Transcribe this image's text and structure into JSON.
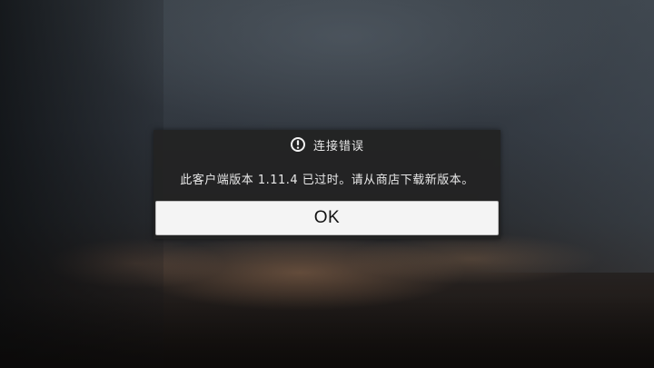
{
  "dialog": {
    "title": "连接错误",
    "title_icon": "alert-circle-icon",
    "message": "此客户端版本 1.11.4 已过时。请从商店下载新版本。",
    "ok_label": "OK"
  },
  "colors": {
    "dialog_bg": "#222222",
    "button_bg": "#f4f4f4",
    "text_light": "#e6e6e6",
    "text_dark": "#111111"
  }
}
